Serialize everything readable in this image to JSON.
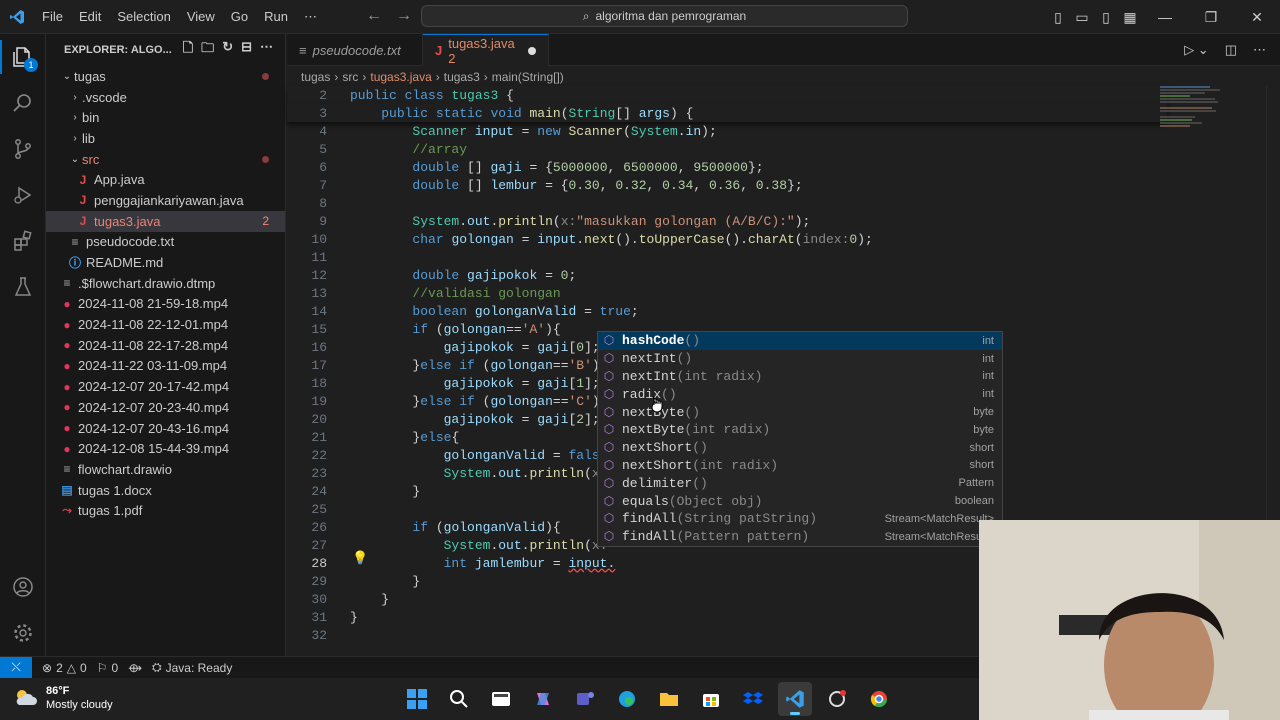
{
  "menu": [
    "File",
    "Edit",
    "Selection",
    "View",
    "Go",
    "Run",
    "⋯"
  ],
  "search_text": "algoritma dan pemrograman",
  "sidebar": {
    "title": "EXPLORER: ALGO...",
    "items": [
      {
        "label": "tugas",
        "type": "folder-open",
        "indent": 0,
        "dot": true
      },
      {
        "label": ".vscode",
        "type": "folder",
        "indent": 1
      },
      {
        "label": "bin",
        "type": "folder",
        "indent": 1
      },
      {
        "label": "lib",
        "type": "folder",
        "indent": 1
      },
      {
        "label": "src",
        "type": "folder-open",
        "indent": 1,
        "dot": true,
        "red": true
      },
      {
        "label": "App.java",
        "type": "java",
        "indent": 2
      },
      {
        "label": "penggajiankariyawan.java",
        "type": "java",
        "indent": 2
      },
      {
        "label": "tugas3.java",
        "type": "java",
        "indent": 2,
        "selected": true,
        "errors": "2",
        "red": true
      },
      {
        "label": "pseudocode.txt",
        "type": "txt",
        "indent": 1
      },
      {
        "label": "README.md",
        "type": "info",
        "indent": 1
      },
      {
        "label": ".$flowchart.drawio.dtmp",
        "type": "plain",
        "indent": 0
      },
      {
        "label": "2024-11-08 21-59-18.mp4",
        "type": "video",
        "indent": 0
      },
      {
        "label": "2024-11-08 22-12-01.mp4",
        "type": "video",
        "indent": 0
      },
      {
        "label": "2024-11-08 22-17-28.mp4",
        "type": "video",
        "indent": 0
      },
      {
        "label": "2024-11-22 03-11-09.mp4",
        "type": "video",
        "indent": 0
      },
      {
        "label": "2024-12-07 20-17-42.mp4",
        "type": "video",
        "indent": 0
      },
      {
        "label": "2024-12-07 20-23-40.mp4",
        "type": "video",
        "indent": 0
      },
      {
        "label": "2024-12-07 20-43-16.mp4",
        "type": "video",
        "indent": 0
      },
      {
        "label": "2024-12-08 15-44-39.mp4",
        "type": "video",
        "indent": 0
      },
      {
        "label": "flowchart.drawio",
        "type": "plain",
        "indent": 0
      },
      {
        "label": "tugas 1.docx",
        "type": "docx",
        "indent": 0
      },
      {
        "label": "tugas 1.pdf",
        "type": "pdf",
        "indent": 0
      }
    ]
  },
  "tabs": [
    {
      "label": "pseudocode.txt",
      "active": false
    },
    {
      "label": "tugas3.java 2",
      "active": true
    }
  ],
  "breadcrumb": [
    "tugas",
    "src",
    "tugas3.java",
    "tugas3",
    "main(String[])"
  ],
  "code": [
    {
      "n": "2",
      "html": "<span class='kw'>public</span> <span class='kw'>class</span> <span class='ty'>tugas3</span> {"
    },
    {
      "n": "3",
      "html": "    <span class='kw'>public</span> <span class='kw'>static</span> <span class='kw'>void</span> <span class='fn'>main</span>(<span class='ty'>String</span>[] <span class='var'>args</span>) {"
    },
    {
      "n": "4",
      "html": "        <span class='ty'>Scanner</span> <span class='var'>input</span> = <span class='kw'>new</span> <span class='fn'>Scanner</span>(<span class='ty'>System</span>.<span class='var'>in</span>);"
    },
    {
      "n": "5",
      "html": "        <span class='cm'>//array</span>"
    },
    {
      "n": "6",
      "html": "        <span class='kw'>double</span> [] <span class='var'>gaji</span> = {<span class='num'>5000000</span>, <span class='num'>6500000</span>, <span class='num'>9500000</span>};"
    },
    {
      "n": "7",
      "html": "        <span class='kw'>double</span> [] <span class='var'>lembur</span> = {<span class='num'>0.30</span>, <span class='num'>0.32</span>, <span class='num'>0.34</span>, <span class='num'>0.36</span>, <span class='num'>0.38</span>};"
    },
    {
      "n": "8",
      "html": ""
    },
    {
      "n": "9",
      "html": "        <span class='ty'>System</span>.<span class='var'>out</span>.<span class='fn'>println</span>(<span class='hint'>x:</span><span class='str'>\"masukkan golongan (A/B/C):\"</span>);"
    },
    {
      "n": "10",
      "html": "        <span class='kw'>char</span> <span class='var'>golongan</span> = <span class='var'>input</span>.<span class='fn'>next</span>().<span class='fn'>toUpperCase</span>().<span class='fn'>charAt</span>(<span class='hint'>index:</span><span class='num'>0</span>);"
    },
    {
      "n": "11",
      "html": ""
    },
    {
      "n": "12",
      "html": "        <span class='kw'>double</span> <span class='var'>gajipokok</span> = <span class='num'>0</span>;"
    },
    {
      "n": "13",
      "html": "        <span class='cm'>//validasi golongan</span>"
    },
    {
      "n": "14",
      "html": "        <span class='kw'>boolean</span> <span class='var'>golonganValid</span> = <span class='kw'>true</span>;"
    },
    {
      "n": "15",
      "html": "        <span class='kw'>if</span> (<span class='var'>golongan</span>==<span class='str'>'A'</span>){"
    },
    {
      "n": "16",
      "html": "            <span class='var'>gajipokok</span> = <span class='var'>gaji</span>[<span class='num'>0</span>];"
    },
    {
      "n": "17",
      "html": "        }<span class='kw'>else</span> <span class='kw'>if</span> (<span class='var'>golongan</span>==<span class='str'>'B'</span>){"
    },
    {
      "n": "18",
      "html": "            <span class='var'>gajipokok</span> = <span class='var'>gaji</span>[<span class='num'>1</span>];"
    },
    {
      "n": "19",
      "html": "        }<span class='kw'>else</span> <span class='kw'>if</span> (<span class='var'>golongan</span>==<span class='str'>'C'</span>){"
    },
    {
      "n": "20",
      "html": "            <span class='var'>gajipokok</span> = <span class='var'>gaji</span>[<span class='num'>2</span>];"
    },
    {
      "n": "21",
      "html": "        }<span class='kw'>else</span>{"
    },
    {
      "n": "22",
      "html": "            <span class='var'>golonganValid</span> = <span class='kw'>false</span>;"
    },
    {
      "n": "23",
      "html": "            <span class='ty'>System</span>.<span class='var'>out</span>.<span class='fn'>println</span>(<span class='hint'>x:</span><span class='str'>\"</span>"
    },
    {
      "n": "24",
      "html": "        }"
    },
    {
      "n": "25",
      "html": ""
    },
    {
      "n": "26",
      "html": "        <span class='kw'>if</span> (<span class='var'>golonganValid</span>){"
    },
    {
      "n": "27",
      "html": "            <span class='ty'>System</span>.<span class='var'>out</span>.<span class='fn'>println</span>(<span class='hint'>x:</span><span class='str'>\"</span>"
    },
    {
      "n": "28",
      "html": "            <span class='kw'>int</span> <span class='var'>jamlembur</span> = <span class='var' style='text-decoration:underline wavy #f14c4c'>input.</span>"
    },
    {
      "n": "29",
      "html": "        }"
    },
    {
      "n": "30",
      "html": "    }"
    },
    {
      "n": "31",
      "html": "}"
    },
    {
      "n": "32",
      "html": ""
    }
  ],
  "suggestions": [
    {
      "name": "hashCode",
      "args": "()",
      "rt": "int",
      "selected": true
    },
    {
      "name": "nextInt",
      "args": "()",
      "rt": "int"
    },
    {
      "name": "nextInt",
      "args": "(int radix)",
      "rt": "int"
    },
    {
      "name": "radix",
      "args": "()",
      "rt": "int"
    },
    {
      "name": "nextByte",
      "args": "()",
      "rt": "byte"
    },
    {
      "name": "nextByte",
      "args": "(int radix)",
      "rt": "byte"
    },
    {
      "name": "nextShort",
      "args": "()",
      "rt": "short"
    },
    {
      "name": "nextShort",
      "args": "(int radix)",
      "rt": "short"
    },
    {
      "name": "delimiter",
      "args": "()",
      "rt": "Pattern"
    },
    {
      "name": "equals",
      "args": "(Object obj)",
      "rt": "boolean"
    },
    {
      "name": "findAll",
      "args": "(String patString)",
      "rt": "Stream<MatchResult>"
    },
    {
      "name": "findAll",
      "args": "(Pattern pattern)",
      "rt": "Stream<MatchResult>"
    }
  ],
  "status": {
    "errors": "2",
    "warnings": "0",
    "info": "0",
    "java": "Java: Ready"
  },
  "weather": {
    "temp": "86°F",
    "desc": "Mostly cloudy"
  }
}
